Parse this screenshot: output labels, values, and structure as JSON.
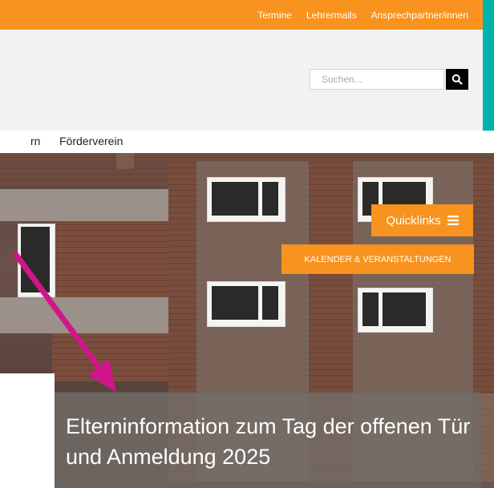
{
  "topbar": {
    "links": [
      "Termine",
      "Lehrermails",
      "Ansprechpartner/innen"
    ]
  },
  "search": {
    "placeholder": "Suchen...",
    "icon": "search-icon"
  },
  "nav": {
    "items": [
      "rn",
      "Förderverein"
    ]
  },
  "quicklinks": {
    "label": "Quicklinks",
    "icon": "hamburger-icon"
  },
  "kalender": {
    "label": "KALENDER & VERANSTALTUNGEN"
  },
  "caption": {
    "text": "Elterninformation zum Tag der offenen Tür und Anmeldung 2025"
  },
  "colors": {
    "brand_orange": "#f7931e",
    "frame_teal": "#00b3ac",
    "arrow_magenta": "#d0168a"
  }
}
